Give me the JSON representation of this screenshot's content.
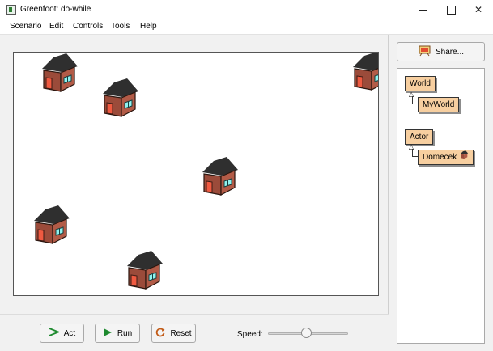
{
  "window": {
    "title": "Greenfoot: do-while",
    "icon": "greenfoot-app-icon"
  },
  "menu": {
    "items": [
      "Scenario",
      "Edit",
      "Controls",
      "Tools",
      "Help"
    ]
  },
  "controls": {
    "act_label": "Act",
    "run_label": "Run",
    "reset_label": "Reset",
    "speed_label": "Speed:",
    "speed_level": 0.48
  },
  "sidebar": {
    "share_label": "Share...",
    "classes": {
      "world": "World",
      "my_world": "MyWorld",
      "actor": "Actor",
      "domecek": "Domecek"
    }
  },
  "colors": {
    "class_box": "#f7cfa0",
    "run_icon": "#1e8a2f",
    "house_wall": "#9b4b3a",
    "house_roof": "#2f2f2f",
    "house_door": "#ef5a41",
    "house_window": "#8ff4f0"
  }
}
